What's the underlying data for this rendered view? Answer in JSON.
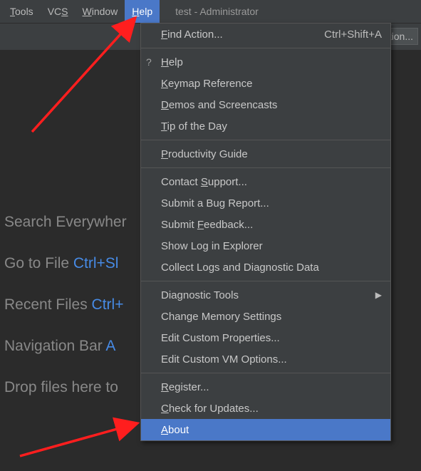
{
  "menubar": {
    "items": [
      {
        "label": "Tools",
        "akey": "T",
        "rest": "ools"
      },
      {
        "label": "VCS",
        "akey": "S",
        "pre": "VC",
        "rest": ""
      },
      {
        "label": "Window",
        "akey": "W",
        "rest": "indow"
      },
      {
        "label": "Help",
        "akey": "H",
        "rest": "elp",
        "active": true
      }
    ],
    "title": "test - Administrator"
  },
  "toolbar": {
    "fragment_text": "ration..."
  },
  "background": {
    "lines": [
      {
        "text": "Search Everywher"
      },
      {
        "text": "Go to File  ",
        "shortcut": "Ctrl+Sl"
      },
      {
        "text": "Recent Files  ",
        "shortcut": "Ctrl+"
      },
      {
        "text": "Navigation Bar  ",
        "shortcut": "A"
      },
      {
        "text": "Drop files here to"
      }
    ]
  },
  "help_menu": {
    "groups": [
      [
        {
          "label_ul": "F",
          "label_rest": "ind Action...",
          "accel": "Ctrl+Shift+A",
          "name": "find-action"
        }
      ],
      [
        {
          "icon": "?",
          "label_ul": "H",
          "label_rest": "elp",
          "name": "help"
        },
        {
          "label_ul": "K",
          "label_rest": "eymap Reference",
          "name": "keymap-reference"
        },
        {
          "label_ul": "D",
          "label_rest": "emos and Screencasts",
          "name": "demos-screencasts"
        },
        {
          "label_ul": "T",
          "label_rest": "ip of the Day",
          "name": "tip-of-the-day"
        }
      ],
      [
        {
          "label_ul": "P",
          "label_rest": "roductivity Guide",
          "name": "productivity-guide"
        }
      ],
      [
        {
          "label_pre": "Contact ",
          "label_ul": "S",
          "label_rest": "upport...",
          "name": "contact-support"
        },
        {
          "label_plain": "Submit a Bug Report...",
          "name": "submit-bug-report"
        },
        {
          "label_pre": "Submit ",
          "label_ul": "F",
          "label_rest": "eedback...",
          "name": "submit-feedback"
        },
        {
          "label_plain": "Show Log in Explorer",
          "name": "show-log"
        },
        {
          "label_plain": "Collect Logs and Diagnostic Data",
          "name": "collect-logs"
        }
      ],
      [
        {
          "label_plain": "Diagnostic Tools",
          "submenu": true,
          "name": "diagnostic-tools"
        },
        {
          "label_plain": "Change Memory Settings",
          "name": "change-memory"
        },
        {
          "label_plain": "Edit Custom Properties...",
          "name": "edit-custom-properties"
        },
        {
          "label_plain": "Edit Custom VM Options...",
          "name": "edit-custom-vm-options"
        }
      ],
      [
        {
          "label_ul": "R",
          "label_rest": "egister...",
          "name": "register"
        },
        {
          "label_ul": "C",
          "label_rest": "heck for Updates...",
          "name": "check-updates"
        },
        {
          "label_ul": "A",
          "label_rest": "bout",
          "name": "about",
          "highlight": true
        }
      ]
    ]
  },
  "colors": {
    "accent": "#4a78c8",
    "arrow": "#ff1e1e",
    "bg_app": "#3c3f41",
    "bg_editor": "#2b2b2b",
    "shortcut_link": "#478be6"
  }
}
